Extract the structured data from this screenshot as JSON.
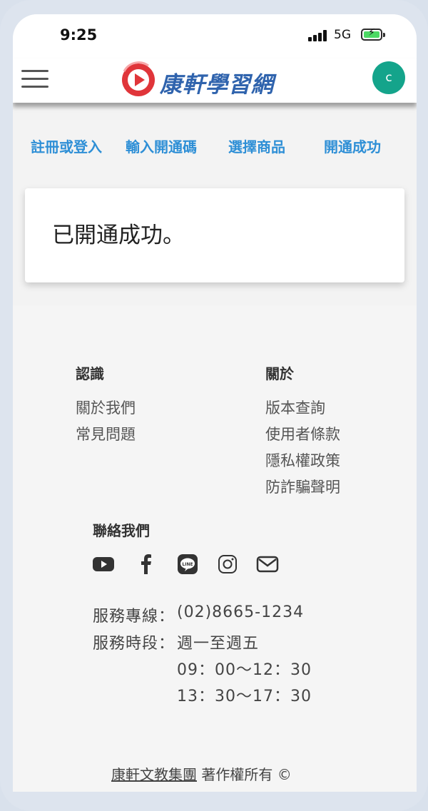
{
  "status_bar": {
    "time": "9:25",
    "network": "5G"
  },
  "header": {
    "logo_text": "康軒學習網",
    "avatar_letter": "c"
  },
  "steps": [
    "註冊或登入",
    "輸入開通碼",
    "選擇商品",
    "開通成功"
  ],
  "card": {
    "message": "已開通成功。"
  },
  "footer": {
    "col1": {
      "title": "認識",
      "links": [
        "關於我們",
        "常見問題"
      ]
    },
    "col2": {
      "title": "關於",
      "links": [
        "版本查詢",
        "使用者條款",
        "隱私權政策",
        "防詐騙聲明"
      ]
    },
    "contact": {
      "title": "聯絡我們",
      "icons": [
        "youtube-icon",
        "facebook-icon",
        "line-icon",
        "instagram-icon",
        "mail-icon"
      ],
      "hotline_label": "服務專線：",
      "hotline_value": "(02)8665-1234",
      "hours_label": "服務時段：",
      "hours_days": "週一至週五",
      "hours_1": "09：00～12：30",
      "hours_2": "13：30～17：30"
    },
    "copyright_link": "康軒文教集團",
    "copyright_text": " 著作權所有 ©"
  },
  "colors": {
    "accent": "#2e8fd6",
    "logo": "#2f63ad",
    "avatar": "#14a48b",
    "logo_red": "#e0353a"
  }
}
